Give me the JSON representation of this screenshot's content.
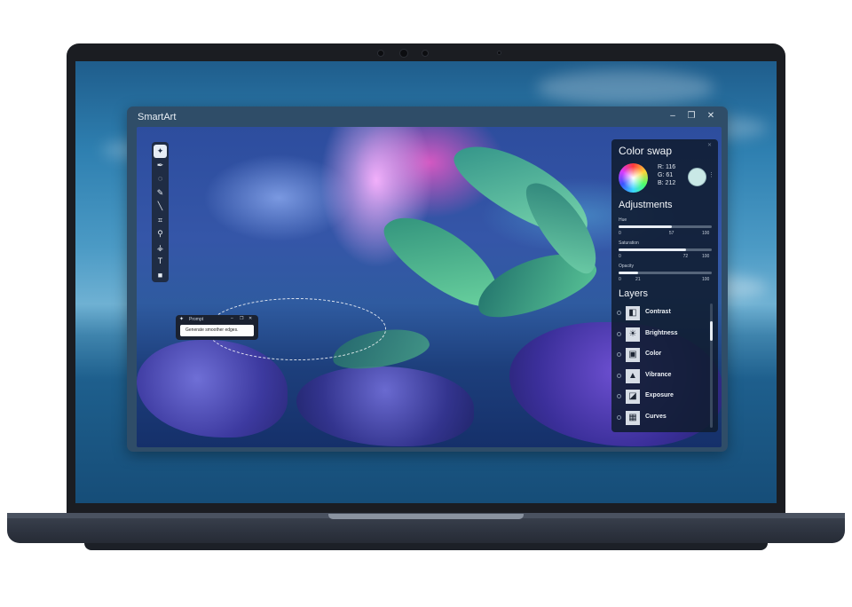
{
  "app": {
    "title": "SmartArt",
    "controls": {
      "minimize": "–",
      "maximize": "❐",
      "close": "✕"
    }
  },
  "toolbar": {
    "tools": [
      {
        "name": "ai-sparkle-icon",
        "glyph": "✦"
      },
      {
        "name": "pen-icon",
        "glyph": "✒"
      },
      {
        "name": "lasso-icon",
        "glyph": "◌"
      },
      {
        "name": "brush-icon",
        "glyph": "✎"
      },
      {
        "name": "line-icon",
        "glyph": "╲"
      },
      {
        "name": "crop-icon",
        "glyph": "⌗"
      },
      {
        "name": "zoom-icon",
        "glyph": "⚲"
      },
      {
        "name": "eyedropper-icon",
        "glyph": "⚶"
      },
      {
        "name": "text-icon",
        "glyph": "T"
      },
      {
        "name": "shape-icon",
        "glyph": "■"
      }
    ]
  },
  "prompt": {
    "title": "Prompt",
    "text": "Generate smoother edges."
  },
  "panel": {
    "color_swap": {
      "heading": "Color swap",
      "r": "R:  116",
      "g": "G:  61",
      "b": "B:  212",
      "swap_color": "#c9e8e6"
    },
    "adjustments": {
      "heading": "Adjustments",
      "sliders": [
        {
          "label": "Hue",
          "min": "0",
          "value": "57",
          "max": "100",
          "fraction": 0.57
        },
        {
          "label": "Saturation",
          "min": "0",
          "value": "72",
          "max": "100",
          "fraction": 0.72
        },
        {
          "label": "Opacity",
          "min": "0",
          "value": "21",
          "max": "100",
          "fraction": 0.21
        }
      ]
    },
    "layers": {
      "heading": "Layers",
      "items": [
        {
          "label": "Contrast",
          "icon": "contrast-icon",
          "glyph": "◧"
        },
        {
          "label": "Brightness",
          "icon": "brightness-icon",
          "glyph": "☀"
        },
        {
          "label": "Color",
          "icon": "color-icon",
          "glyph": "▣"
        },
        {
          "label": "Vibrance",
          "icon": "vibrance-icon",
          "glyph": "▲"
        },
        {
          "label": "Exposure",
          "icon": "exposure-icon",
          "glyph": "◪"
        },
        {
          "label": "Curves",
          "icon": "curves-icon",
          "glyph": "▦"
        }
      ]
    }
  }
}
